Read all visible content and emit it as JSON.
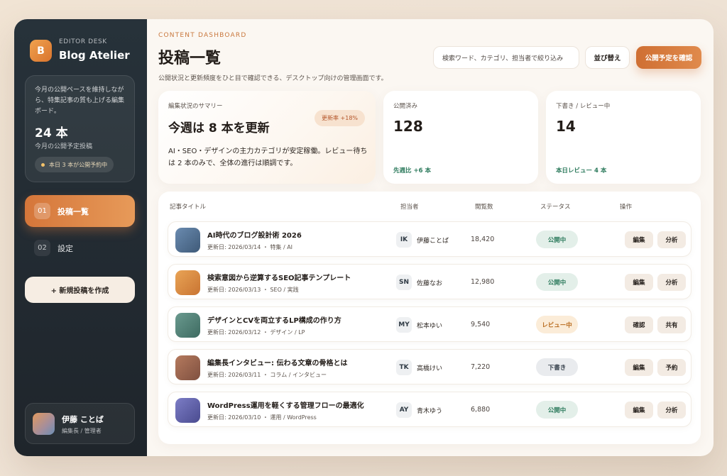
{
  "sidebar": {
    "logo_letter": "B",
    "brand_sub": "EDITOR DESK",
    "brand_title": "Blog Atelier",
    "stat": {
      "desc": "今月の公開ペースを維持しながら、特集記事の質も上げる編集ボード。",
      "value": "24 本",
      "label": "今月の公開予定投稿",
      "pill": "本日 3 本が公開予約中"
    },
    "nav": [
      {
        "num": "01",
        "label": "投稿一覧",
        "active": true
      },
      {
        "num": "02",
        "label": "設定",
        "active": false
      }
    ],
    "new_post": "+ 新規投稿を作成",
    "profile": {
      "name": "伊藤 ことば",
      "role": "編集長 / 管理者"
    }
  },
  "header": {
    "eyebrow": "CONTENT DASHBOARD",
    "title": "投稿一覧",
    "desc": "公開状況と更新頻度をひと目で確認できる、デスクトップ向けの管理画面です。",
    "search_placeholder": "検索ワード、カテゴリ、担当者で絞り込み",
    "sort_label": "並び替え",
    "schedule_label": "公開予定を確認"
  },
  "summary": {
    "label": "編集状況のサマリー",
    "headline": "今週は 8 本を更新",
    "badge": "更新率 +18%",
    "text": "AI・SEO・デザインの主力カテゴリが安定稼働。レビュー待ちは 2 本のみで、全体の進行は順調です。"
  },
  "kpis": [
    {
      "label": "公開済み",
      "value": "128",
      "foot": "先週比 +6 本"
    },
    {
      "label": "下書き / レビュー中",
      "value": "14",
      "foot": "本日レビュー 4 本"
    }
  ],
  "table": {
    "headers": [
      "記事タイトル",
      "担当者",
      "閲覧数",
      "ステータス",
      "操作"
    ],
    "rows": [
      {
        "title": "AI時代のブログ設計術 2026",
        "meta": "更新日: 2026/03/14 ・ 特集 / AI",
        "initials": "IK",
        "author": "伊藤ことば",
        "views": "18,420",
        "status": "公開中",
        "status_type": "pub",
        "actions": [
          "編集",
          "分析"
        ],
        "thumb_color": "#4f6f93"
      },
      {
        "title": "検索意図から逆算するSEO記事テンプレート",
        "meta": "更新日: 2026/03/13 ・ SEO / 実践",
        "initials": "SN",
        "author": "佐藤なお",
        "views": "12,980",
        "status": "公開中",
        "status_type": "pub",
        "actions": [
          "編集",
          "分析"
        ],
        "thumb_color": "#d9893f"
      },
      {
        "title": "デザインとCVを両立するLP構成の作り方",
        "meta": "更新日: 2026/03/12 ・ デザイン / LP",
        "initials": "MY",
        "author": "松本ゆい",
        "views": "9,540",
        "status": "レビュー中",
        "status_type": "review",
        "actions": [
          "確認",
          "共有"
        ],
        "thumb_color": "#4f7f74"
      },
      {
        "title": "編集長インタビュー: 伝わる文章の骨格とは",
        "meta": "更新日: 2026/03/11 ・ コラム / インタビュー",
        "initials": "TK",
        "author": "高橋けい",
        "views": "7,220",
        "status": "下書き",
        "status_type": "draft",
        "actions": [
          "編集",
          "予約"
        ],
        "thumb_color": "#9a6650"
      },
      {
        "title": "WordPress運用を軽くする管理フローの最適化",
        "meta": "更新日: 2026/03/10 ・ 運用 / WordPress",
        "initials": "AY",
        "author": "青木ゆう",
        "views": "6,880",
        "status": "公開中",
        "status_type": "pub",
        "actions": [
          "編集",
          "分析"
        ],
        "thumb_color": "#5d5ea8"
      }
    ]
  }
}
